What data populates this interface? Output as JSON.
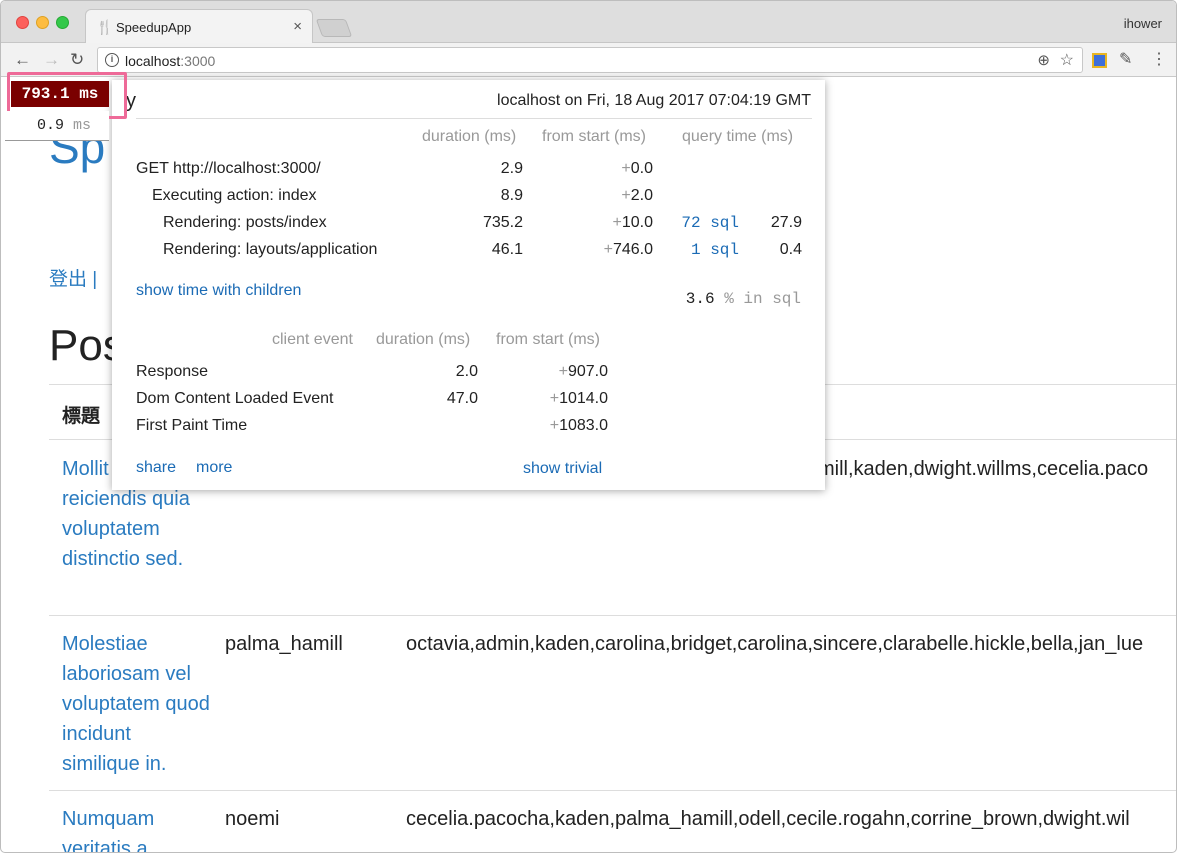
{
  "browser": {
    "tab_title": "SpeedupApp",
    "tab_close": "×",
    "profile_name": "ihower",
    "url_host": "localhost",
    "url_port": ":3000",
    "nav_back": "←",
    "nav_forward": "→",
    "nav_reload": "↻",
    "info_glyph": "i",
    "zoom_glyph": "⊕",
    "star_glyph": "☆",
    "brush_glyph": "✎",
    "menu_glyph": "⋮",
    "tab_favicon": "🍴"
  },
  "page": {
    "title_visible": "Sp",
    "nav_links": "登出 | ",
    "heading_visible": "Pos",
    "table_header": "標題",
    "rows": [
      {
        "title": "Mollit voluptates reiciendis quia voluptatem distinctio sed.",
        "author": "",
        "tags": "mill,kaden,dwight.willms,cecelia.paco"
      },
      {
        "title": "Molestiae laboriosam vel voluptatem quod incidunt similique in.",
        "author": "palma_hamill",
        "tags": "octavia,admin,kaden,carolina,bridget,carolina,sincere,clarabelle.hickle,bella,jan_lue"
      },
      {
        "title": "Numquam veritatis a",
        "author": "noemi",
        "tags": "cecelia.pacocha,kaden,palma_hamill,odell,cecile.rogahn,corrine_brown,dwight.wil"
      }
    ]
  },
  "profiler": {
    "badge_total": "793.1 ms",
    "badge_sub_value": "0.9",
    "badge_sub_unit": "ms",
    "head_clip": "y",
    "header": "localhost on Fri, 18 Aug 2017 07:04:19 GMT",
    "columns": {
      "duration": "duration (ms)",
      "from_start": "from start (ms)",
      "query_time": "query time (ms)"
    },
    "timings": [
      {
        "name": "GET http://localhost:3000/",
        "duration": "2.9",
        "from_start": "0.0",
        "sql_count": "",
        "sql_time": ""
      },
      {
        "name": "Executing action: index",
        "duration": "8.9",
        "from_start": "2.0",
        "sql_count": "",
        "sql_time": ""
      },
      {
        "name": "Rendering: posts/index",
        "duration": "735.2",
        "from_start": "10.0",
        "sql_count": "72 sql",
        "sql_time": "27.9"
      },
      {
        "name": "Rendering: layouts/application",
        "duration": "46.1",
        "from_start": "746.0",
        "sql_count": "1 sql",
        "sql_time": "0.4"
      }
    ],
    "plus_sign": "+",
    "show_children": "show time with children",
    "sql_percent_value": "3.6",
    "sql_percent_unit": "% in sql",
    "client_columns": {
      "event": "client event",
      "duration": "duration (ms)",
      "from_start": "from start (ms)"
    },
    "client_events": [
      {
        "name": "Response",
        "duration": "2.0",
        "from_start": "907.0"
      },
      {
        "name": "Dom Content Loaded Event",
        "duration": "47.0",
        "from_start": "1014.0"
      },
      {
        "name": "First Paint Time",
        "duration": "",
        "from_start": "1083.0"
      }
    ],
    "share_link": "share",
    "more_link": "more",
    "show_trivial": "show trivial"
  }
}
